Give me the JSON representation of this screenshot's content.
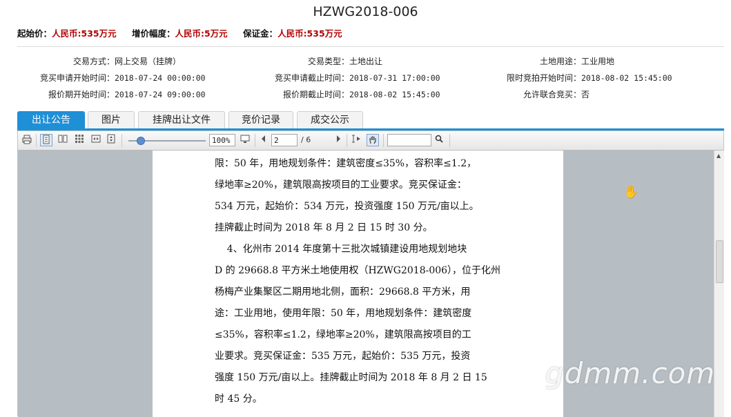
{
  "title": "HZWG2018-006",
  "pricebar": {
    "start_label": "起始价：",
    "start_value": "人民币:535万元",
    "step_label": "增价幅度：",
    "step_value": "人民币:5万元",
    "deposit_label": "保证金：",
    "deposit_value": "人民币:535万元"
  },
  "info": {
    "trade_method_k": "交易方式：",
    "trade_method_v": "网上交易（挂牌）",
    "trade_type_k": "交易类型：",
    "trade_type_v": "土地出让",
    "land_use_k": "土地用途：",
    "land_use_v": "工业用地",
    "apply_start_k": "竞买申请开始时间：",
    "apply_start_v": "2018-07-24 00:00:00",
    "apply_end_k": "竞买申请截止时间：",
    "apply_end_v": "2018-07-31 17:00:00",
    "bid_start_k": "限时竞拍开始时间：",
    "bid_start_v": "2018-08-02 15:45:00",
    "quote_start_k": "报价期开始时间：",
    "quote_start_v": "2018-07-24 09:00:00",
    "quote_end_k": "报价期截止时间：",
    "quote_end_v": "2018-08-02 15:45:00",
    "joint_k": "允许联合竞买：",
    "joint_v": "否"
  },
  "tabs": [
    "出让公告",
    "图片",
    "挂牌出让文件",
    "竞价记录",
    "成交公示"
  ],
  "viewer": {
    "zoom": "100%",
    "page": "2",
    "page_total": "/ 6",
    "search": ""
  },
  "doc_lines": [
    "限：50 年，用地规划条件：建筑密度≤35%，容积率≤1.2，",
    "绿地率≥20%，建筑限高按项目的工业要求。竞买保证金：",
    "534 万元，起始价：534 万元，投资强度 150 万元/亩以上。",
    "挂牌截止时间为 2018 年 8 月 2 日 15 时 30 分。",
    "    4、化州市 2014 年度第十三批次城镇建设用地规划地块",
    "D 的 29668.8 平方米土地使用权（HZWG2018-006），位于化州",
    "杨梅产业集聚区二期用地北侧，面积：29668.8 平方米，用",
    "途：工业用地，使用年限：50 年，用地规划条件：建筑密度",
    "≤35%，容积率≤1.2，绿地率≥20%，建筑限高按项目的工",
    "业要求。竞买保证金：535 万元，起始价：535 万元，投资",
    "强度 150 万元/亩以上。挂牌截止时间为 2018 年 8 月 2 日 15",
    "时 45 分。"
  ],
  "watermark": "gdmm.com",
  "colors": {
    "accent": "#1f8fd6",
    "price": "#b30000",
    "doc_bg": "#b6bec4"
  }
}
